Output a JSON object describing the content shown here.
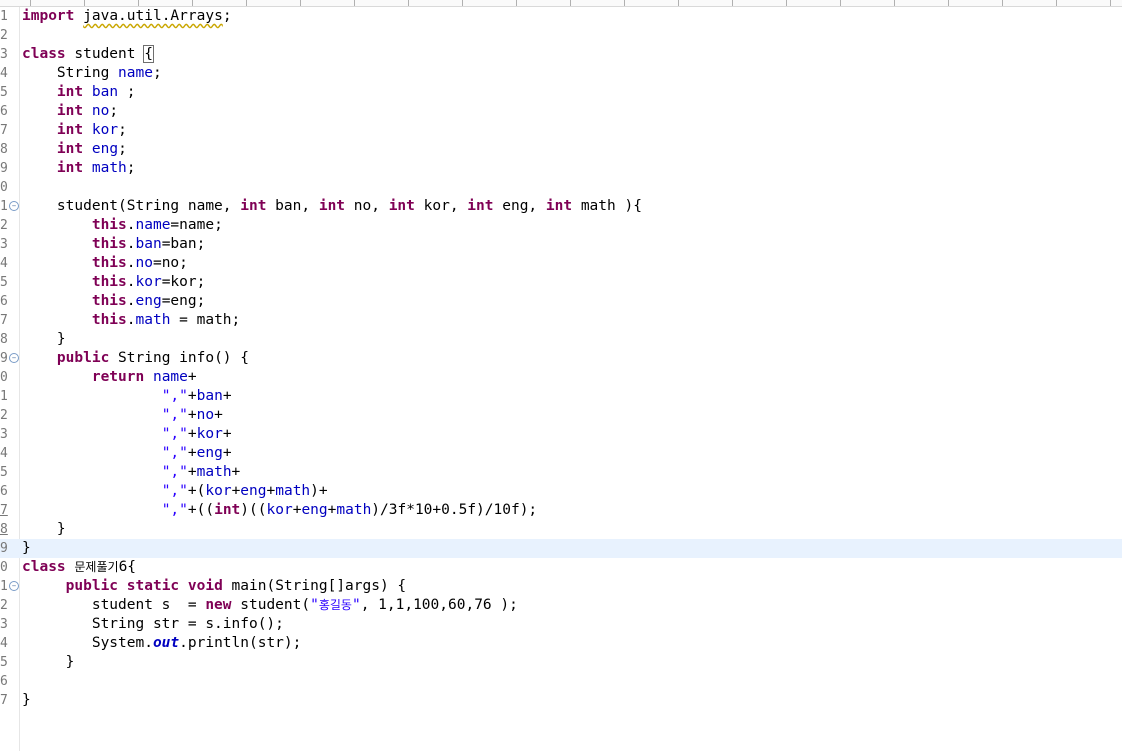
{
  "editor": {
    "lines": [
      {
        "n": "1",
        "tokens": [
          {
            "t": "import",
            "c": "kw"
          },
          {
            "t": " "
          },
          {
            "t": "java.util.Arrays",
            "c": "warn"
          },
          {
            "t": ";"
          }
        ]
      },
      {
        "n": "2",
        "tokens": []
      },
      {
        "n": "3",
        "tokens": [
          {
            "t": "class",
            "c": "kw"
          },
          {
            "t": " student "
          },
          {
            "t": "{",
            "c": "brace"
          }
        ]
      },
      {
        "n": "4",
        "tokens": [
          {
            "t": "    String "
          },
          {
            "t": "name",
            "c": "fld"
          },
          {
            "t": ";"
          }
        ]
      },
      {
        "n": "5",
        "tokens": [
          {
            "t": "    "
          },
          {
            "t": "int",
            "c": "kw"
          },
          {
            "t": " "
          },
          {
            "t": "ban",
            "c": "fld"
          },
          {
            "t": " ;"
          }
        ]
      },
      {
        "n": "6",
        "tokens": [
          {
            "t": "    "
          },
          {
            "t": "int",
            "c": "kw"
          },
          {
            "t": " "
          },
          {
            "t": "no",
            "c": "fld"
          },
          {
            "t": ";"
          }
        ]
      },
      {
        "n": "7",
        "tokens": [
          {
            "t": "    "
          },
          {
            "t": "int",
            "c": "kw"
          },
          {
            "t": " "
          },
          {
            "t": "kor",
            "c": "fld"
          },
          {
            "t": ";"
          }
        ]
      },
      {
        "n": "8",
        "tokens": [
          {
            "t": "    "
          },
          {
            "t": "int",
            "c": "kw"
          },
          {
            "t": " "
          },
          {
            "t": "eng",
            "c": "fld"
          },
          {
            "t": ";"
          }
        ]
      },
      {
        "n": "9",
        "tokens": [
          {
            "t": "    "
          },
          {
            "t": "int",
            "c": "kw"
          },
          {
            "t": " "
          },
          {
            "t": "math",
            "c": "fld"
          },
          {
            "t": ";"
          }
        ]
      },
      {
        "n": "0",
        "tokens": []
      },
      {
        "n": "1",
        "fold": true,
        "tokens": [
          {
            "t": "    student(String name, "
          },
          {
            "t": "int",
            "c": "kw"
          },
          {
            "t": " ban, "
          },
          {
            "t": "int",
            "c": "kw"
          },
          {
            "t": " no, "
          },
          {
            "t": "int",
            "c": "kw"
          },
          {
            "t": " kor, "
          },
          {
            "t": "int",
            "c": "kw"
          },
          {
            "t": " eng, "
          },
          {
            "t": "int",
            "c": "kw"
          },
          {
            "t": " math ){"
          }
        ]
      },
      {
        "n": "2",
        "tokens": [
          {
            "t": "        "
          },
          {
            "t": "this",
            "c": "kw"
          },
          {
            "t": "."
          },
          {
            "t": "name",
            "c": "fld"
          },
          {
            "t": "=name;"
          }
        ]
      },
      {
        "n": "3",
        "tokens": [
          {
            "t": "        "
          },
          {
            "t": "this",
            "c": "kw"
          },
          {
            "t": "."
          },
          {
            "t": "ban",
            "c": "fld"
          },
          {
            "t": "=ban;"
          }
        ]
      },
      {
        "n": "4",
        "tokens": [
          {
            "t": "        "
          },
          {
            "t": "this",
            "c": "kw"
          },
          {
            "t": "."
          },
          {
            "t": "no",
            "c": "fld"
          },
          {
            "t": "=no;"
          }
        ]
      },
      {
        "n": "5",
        "tokens": [
          {
            "t": "        "
          },
          {
            "t": "this",
            "c": "kw"
          },
          {
            "t": "."
          },
          {
            "t": "kor",
            "c": "fld"
          },
          {
            "t": "=kor;"
          }
        ]
      },
      {
        "n": "6",
        "tokens": [
          {
            "t": "        "
          },
          {
            "t": "this",
            "c": "kw"
          },
          {
            "t": "."
          },
          {
            "t": "eng",
            "c": "fld"
          },
          {
            "t": "=eng;"
          }
        ]
      },
      {
        "n": "7",
        "tokens": [
          {
            "t": "        "
          },
          {
            "t": "this",
            "c": "kw"
          },
          {
            "t": "."
          },
          {
            "t": "math",
            "c": "fld"
          },
          {
            "t": " = math;"
          }
        ]
      },
      {
        "n": "8",
        "tokens": [
          {
            "t": "    }"
          }
        ]
      },
      {
        "n": "9",
        "fold": true,
        "tokens": [
          {
            "t": "    "
          },
          {
            "t": "public",
            "c": "kw"
          },
          {
            "t": " String info() {"
          }
        ]
      },
      {
        "n": "0",
        "tokens": [
          {
            "t": "        "
          },
          {
            "t": "return",
            "c": "kw"
          },
          {
            "t": " "
          },
          {
            "t": "name",
            "c": "fld"
          },
          {
            "t": "+"
          }
        ]
      },
      {
        "n": "1",
        "tokens": [
          {
            "t": "                "
          },
          {
            "t": "\",\"",
            "c": "str"
          },
          {
            "t": "+"
          },
          {
            "t": "ban",
            "c": "fld"
          },
          {
            "t": "+"
          }
        ]
      },
      {
        "n": "2",
        "tokens": [
          {
            "t": "                "
          },
          {
            "t": "\",\"",
            "c": "str"
          },
          {
            "t": "+"
          },
          {
            "t": "no",
            "c": "fld"
          },
          {
            "t": "+"
          }
        ]
      },
      {
        "n": "3",
        "tokens": [
          {
            "t": "                "
          },
          {
            "t": "\",\"",
            "c": "str"
          },
          {
            "t": "+"
          },
          {
            "t": "kor",
            "c": "fld"
          },
          {
            "t": "+"
          }
        ]
      },
      {
        "n": "4",
        "tokens": [
          {
            "t": "                "
          },
          {
            "t": "\",\"",
            "c": "str"
          },
          {
            "t": "+"
          },
          {
            "t": "eng",
            "c": "fld"
          },
          {
            "t": "+"
          }
        ]
      },
      {
        "n": "5",
        "tokens": [
          {
            "t": "                "
          },
          {
            "t": "\",\"",
            "c": "str"
          },
          {
            "t": "+"
          },
          {
            "t": "math",
            "c": "fld"
          },
          {
            "t": "+"
          }
        ]
      },
      {
        "n": "6",
        "tokens": [
          {
            "t": "                "
          },
          {
            "t": "\",\"",
            "c": "str"
          },
          {
            "t": "+("
          },
          {
            "t": "kor",
            "c": "fld"
          },
          {
            "t": "+"
          },
          {
            "t": "eng",
            "c": "fld"
          },
          {
            "t": "+"
          },
          {
            "t": "math",
            "c": "fld"
          },
          {
            "t": ")+"
          }
        ]
      },
      {
        "n": "7",
        "ul": true,
        "tokens": [
          {
            "t": "                "
          },
          {
            "t": "\",\"",
            "c": "str"
          },
          {
            "t": "+(("
          },
          {
            "t": "int",
            "c": "kw"
          },
          {
            "t": ")(("
          },
          {
            "t": "kor",
            "c": "fld"
          },
          {
            "t": "+"
          },
          {
            "t": "eng",
            "c": "fld"
          },
          {
            "t": "+"
          },
          {
            "t": "math",
            "c": "fld"
          },
          {
            "t": ")/3f*10+0.5f)/10f);"
          }
        ]
      },
      {
        "n": "8",
        "ul": true,
        "tokens": [
          {
            "t": "    }"
          }
        ]
      },
      {
        "n": "9",
        "current": true,
        "tokens": [
          {
            "t": "}"
          }
        ]
      },
      {
        "n": "0",
        "tokens": [
          {
            "t": "class",
            "c": "kw"
          },
          {
            "t": " "
          },
          {
            "t": "문제풀기",
            "c": "ko"
          },
          {
            "t": "6{"
          }
        ]
      },
      {
        "n": "1",
        "fold": true,
        "tokens": [
          {
            "t": "     "
          },
          {
            "t": "public",
            "c": "kw"
          },
          {
            "t": " "
          },
          {
            "t": "static",
            "c": "kw"
          },
          {
            "t": " "
          },
          {
            "t": "void",
            "c": "kw"
          },
          {
            "t": " main(String[]args) {"
          }
        ]
      },
      {
        "n": "2",
        "tokens": [
          {
            "t": "        student s  = "
          },
          {
            "t": "new",
            "c": "kw"
          },
          {
            "t": " student("
          },
          {
            "t": "\"",
            "c": "str"
          },
          {
            "t": "홍길동",
            "c": "str ko"
          },
          {
            "t": "\"",
            "c": "str"
          },
          {
            "t": ", 1,1,100,60,76 );"
          }
        ]
      },
      {
        "n": "3",
        "tokens": [
          {
            "t": "        String str = s.info();"
          }
        ]
      },
      {
        "n": "4",
        "tokens": [
          {
            "t": "        System."
          },
          {
            "t": "out",
            "c": "st"
          },
          {
            "t": ".println(str);"
          }
        ]
      },
      {
        "n": "5",
        "tokens": [
          {
            "t": "     }"
          }
        ]
      },
      {
        "n": "6",
        "tokens": []
      },
      {
        "n": "7",
        "tokens": [
          {
            "t": "}"
          }
        ]
      }
    ]
  }
}
